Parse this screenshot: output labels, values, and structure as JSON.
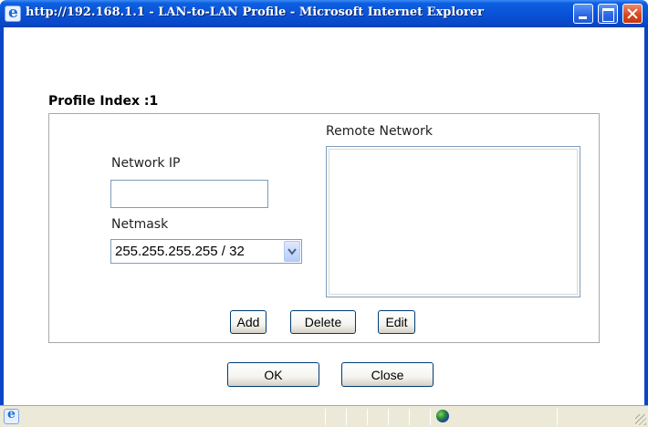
{
  "window": {
    "title": "http://192.168.1.1 - LAN-to-LAN Profile - Microsoft Internet Explorer"
  },
  "titlebar_icon": "ie-icon",
  "titlebar_buttons": [
    "minimize-icon",
    "maximize-icon",
    "close-icon"
  ],
  "form": {
    "profile_index": "Profile Index :1",
    "network_ip_label": "Network IP",
    "network_ip_value": "",
    "netmask_label": "Netmask",
    "netmask_selected": "255.255.255.255 / 32",
    "remote_network_label": "Remote Network",
    "remote_network_items": []
  },
  "buttons": {
    "add": "Add",
    "delete": "Delete",
    "edit": "Edit",
    "ok": "OK",
    "close": "Close"
  },
  "statusbar": {
    "icons": [
      "ie-page-icon",
      "internet-zone-icon"
    ]
  },
  "colors": {
    "titlebar": "#0a52d6",
    "close_button": "#d6451c",
    "statusbar": "#ece9d8",
    "input_border": "#7f9db9"
  }
}
